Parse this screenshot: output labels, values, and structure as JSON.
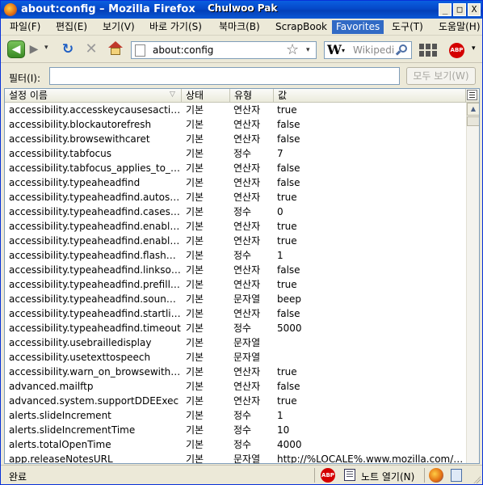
{
  "window": {
    "title": "about:config – Mozilla Firefox",
    "user": "Chulwoo Pak",
    "buttons": {
      "minimize": "_",
      "maximize": "□",
      "close": "X"
    }
  },
  "menu": [
    {
      "label": "파일(F)"
    },
    {
      "label": "편집(E)"
    },
    {
      "label": "보기(V)"
    },
    {
      "label": "바로 가기(S)"
    },
    {
      "label": "북마크(B)"
    },
    {
      "label": "ScrapBook"
    },
    {
      "label": "Favorites"
    },
    {
      "label": "도구(T)"
    },
    {
      "label": "도움말(H)"
    }
  ],
  "toolbar": {
    "back": "◀",
    "forward": "▶",
    "dropdown": "▾",
    "reload": "↻",
    "stop": "✕",
    "url": "about:config",
    "star": "☆",
    "search_engine": "W",
    "search_placeholder": "Wikipedia",
    "abp": "ABP"
  },
  "filter": {
    "label": "필터(I):",
    "value": "",
    "show_all": "모두 보기(W)"
  },
  "table": {
    "headers": {
      "name": "설정 이름",
      "status": "상태",
      "type": "유형",
      "value": "값"
    },
    "rows": [
      {
        "name": "accessibility.accesskeycausesactivation",
        "status": "기본",
        "type": "연산자",
        "value": "true"
      },
      {
        "name": "accessibility.blockautorefresh",
        "status": "기본",
        "type": "연산자",
        "value": "false"
      },
      {
        "name": "accessibility.browsewithcaret",
        "status": "기본",
        "type": "연산자",
        "value": "false"
      },
      {
        "name": "accessibility.tabfocus",
        "status": "기본",
        "type": "정수",
        "value": "7"
      },
      {
        "name": "accessibility.tabfocus_applies_to_xul",
        "status": "기본",
        "type": "연산자",
        "value": "false"
      },
      {
        "name": "accessibility.typeaheadfind",
        "status": "기본",
        "type": "연산자",
        "value": "false"
      },
      {
        "name": "accessibility.typeaheadfind.autostart",
        "status": "기본",
        "type": "연산자",
        "value": "true"
      },
      {
        "name": "accessibility.typeaheadfind.casesensitive",
        "status": "기본",
        "type": "정수",
        "value": "0"
      },
      {
        "name": "accessibility.typeaheadfind.enablesound",
        "status": "기본",
        "type": "연산자",
        "value": "true"
      },
      {
        "name": "accessibility.typeaheadfind.enabletimeout",
        "status": "기본",
        "type": "연산자",
        "value": "true"
      },
      {
        "name": "accessibility.typeaheadfind.flashBar",
        "status": "기본",
        "type": "정수",
        "value": "1"
      },
      {
        "name": "accessibility.typeaheadfind.linksonly",
        "status": "기본",
        "type": "연산자",
        "value": "false"
      },
      {
        "name": "accessibility.typeaheadfind.prefillwithselection",
        "status": "기본",
        "type": "연산자",
        "value": "true"
      },
      {
        "name": "accessibility.typeaheadfind.soundURL",
        "status": "기본",
        "type": "문자열",
        "value": "beep"
      },
      {
        "name": "accessibility.typeaheadfind.startlinksonly",
        "status": "기본",
        "type": "연산자",
        "value": "false"
      },
      {
        "name": "accessibility.typeaheadfind.timeout",
        "status": "기본",
        "type": "정수",
        "value": "5000"
      },
      {
        "name": "accessibility.usebrailledisplay",
        "status": "기본",
        "type": "문자열",
        "value": ""
      },
      {
        "name": "accessibility.usetexttospeech",
        "status": "기본",
        "type": "문자열",
        "value": ""
      },
      {
        "name": "accessibility.warn_on_browsewithcaret",
        "status": "기본",
        "type": "연산자",
        "value": "true"
      },
      {
        "name": "advanced.mailftp",
        "status": "기본",
        "type": "연산자",
        "value": "false"
      },
      {
        "name": "advanced.system.supportDDEExec",
        "status": "기본",
        "type": "연산자",
        "value": "true"
      },
      {
        "name": "alerts.slideIncrement",
        "status": "기본",
        "type": "정수",
        "value": "1"
      },
      {
        "name": "alerts.slideIncrementTime",
        "status": "기본",
        "type": "정수",
        "value": "10"
      },
      {
        "name": "alerts.totalOpenTime",
        "status": "기본",
        "type": "정수",
        "value": "4000"
      },
      {
        "name": "app.releaseNotesURL",
        "status": "기본",
        "type": "문자열",
        "value": "http://%LOCALE%.www.mozilla.com/%LOCALE%/firefox/releasenotes/"
      }
    ]
  },
  "scroll": {
    "up": "▲"
  },
  "status": {
    "text": "완료",
    "abp": "ABP",
    "notes": "노트 열기(N)"
  }
}
